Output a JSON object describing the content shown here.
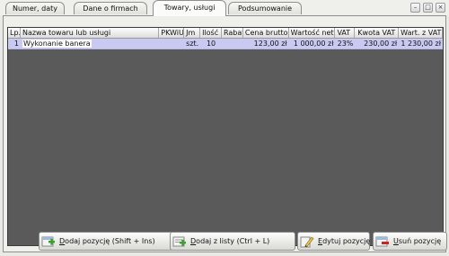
{
  "tabs": [
    {
      "label": "Numer, daty"
    },
    {
      "label": "Dane o firmach"
    },
    {
      "label": "Towary, usługi",
      "active": true
    },
    {
      "label": "Podsumowanie"
    }
  ],
  "table": {
    "columns": [
      "Lp.",
      "Nazwa towaru lub usługi",
      "PKWiU",
      "Jm",
      "Ilość",
      "Rabat",
      "Cena brutto",
      "Wartość netto",
      "VAT",
      "Kwota VAT",
      "Wart. z VAT"
    ],
    "rows": [
      {
        "lp": "1",
        "name": "Wykonanie banera",
        "pkwiu": "",
        "jm": "szt.",
        "ilosc": "10",
        "rabat": "",
        "cena_brutto": "123,00 zł",
        "wartosc_netto": "1 000,00 zł",
        "vat": "23%",
        "kwota_vat": "230,00 zł",
        "wart_z_vat": "1 230,00 zł"
      }
    ]
  },
  "buttons": {
    "add_item": {
      "pre": "",
      "accel": "D",
      "post": "odaj pozycję (Shift + Ins)"
    },
    "add_from_list": {
      "pre": "",
      "accel": "D",
      "post": "odaj z listy (Ctrl + L)"
    },
    "edit_item": {
      "pre": "",
      "accel": "E",
      "post": "dytuj pozycję"
    },
    "delete_item": {
      "pre": "",
      "accel": "U",
      "post": "suń pozycję"
    }
  },
  "icons": [
    "add-icon",
    "add-from-list-icon",
    "edit-icon",
    "delete-icon",
    "dropdown-arrow-icon",
    "minimize-icon",
    "restore-icon",
    "close-icon"
  ],
  "colors": {
    "selected_row": "#c9c9f1",
    "grid_bg": "#5a5a5a",
    "add_green": "#3aa12e",
    "delete_red": "#d22020"
  }
}
